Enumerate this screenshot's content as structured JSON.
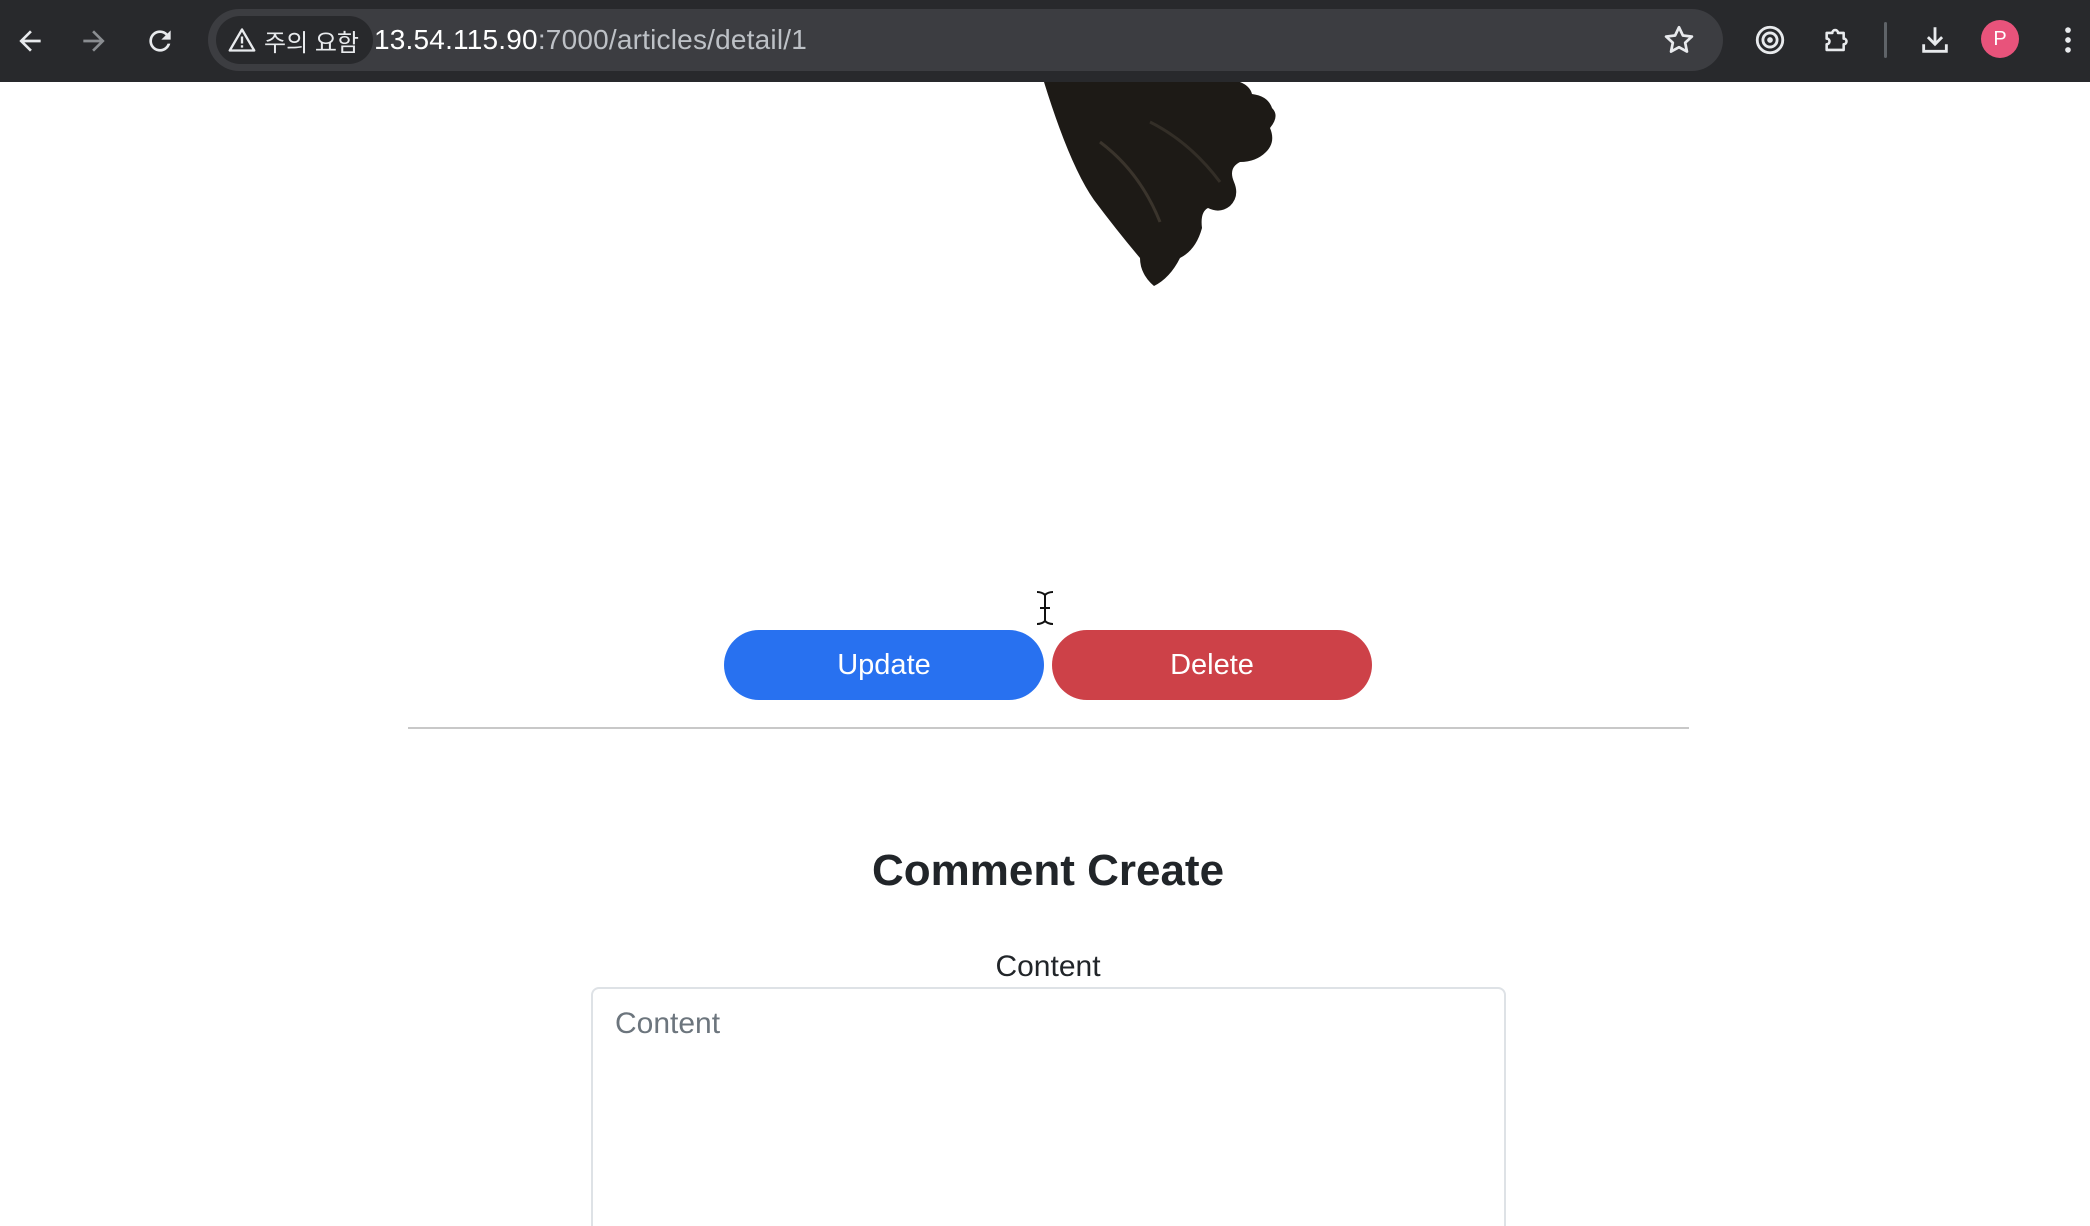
{
  "browser": {
    "security_label": "주의 요함",
    "url_host": "13.54.115.90",
    "url_path": ":7000/articles/detail/1",
    "profile_initial": "P",
    "colors": {
      "toolbar": "#28292c",
      "omnibox": "#3c3d41",
      "avatar": "#e8537b"
    }
  },
  "article": {
    "update_label": "Update",
    "delete_label": "Delete",
    "colors": {
      "update": "#2871f0",
      "delete": "#cd4148"
    }
  },
  "comment_form": {
    "title": "Comment Create",
    "content_label": "Content",
    "content_placeholder": "Content",
    "content_value": ""
  }
}
